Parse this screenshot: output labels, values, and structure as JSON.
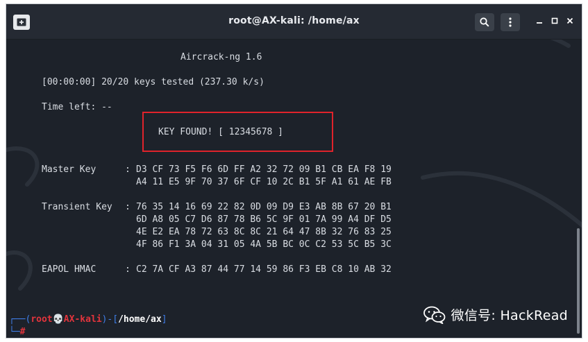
{
  "window": {
    "title": "root@AX-kali: /home/ax",
    "buttons": {
      "new_tab_icon": "terminal-plus-icon",
      "search_icon": "search-icon",
      "menu_icon": "kebab-menu-icon",
      "minimize_icon": "minimize-icon",
      "maximize_icon": "maximize-icon",
      "close_icon": "close-icon"
    }
  },
  "terminal": {
    "header": "Aircrack-ng 1.6",
    "progress": "[00:00:00] 20/20 keys tested (237.30 k/s)",
    "time_left": "Time left: --",
    "key_found": "KEY FOUND! [ 12345678 ]",
    "master_key_label": "Master Key",
    "master_key_rows": [
      "D3 CF 73 F5 F6 6D FF A2 32 72 09 B1 CB EA F8 19",
      "A4 11 E5 9F 70 37 6F CF 10 2C B1 5F A1 61 AE FB"
    ],
    "transient_key_label": "Transient Key",
    "transient_key_rows": [
      "76 35 14 16 69 22 82 0D 09 D9 E3 AB 8B 67 20 B1",
      "6D A8 05 C7 D6 87 78 B6 5C 9F 01 7A 99 A4 DF D5",
      "4E E2 EA 78 72 63 8C 8C 21 64 47 8B 32 76 83 25",
      "4F 86 F1 3A 04 31 05 4A 5B BC 0C C2 53 5C B5 3C"
    ],
    "eapol_label": "EAPOL HMAC",
    "eapol_row": "C2 7A CF A3 87 44 77 14 59 86 F3 EB C8 10 AB 32",
    "separator": ":",
    "prompt": {
      "open": "┌──(",
      "user": "root💀AX-kali",
      "mid": ")-[",
      "path": "/home/ax",
      "close": "]",
      "second_prefix": "└─",
      "symbol": "#"
    }
  },
  "watermark": {
    "text": "微信号: HackRead",
    "icon": "wechat-icon"
  },
  "colors": {
    "terminal_bg": "#1d222a",
    "titlebar_bg": "#252a33",
    "text": "#d9dde3",
    "highlight_box": "#e0232b",
    "prompt_red": "#e2343c",
    "prompt_blue": "#3f7ee8"
  }
}
